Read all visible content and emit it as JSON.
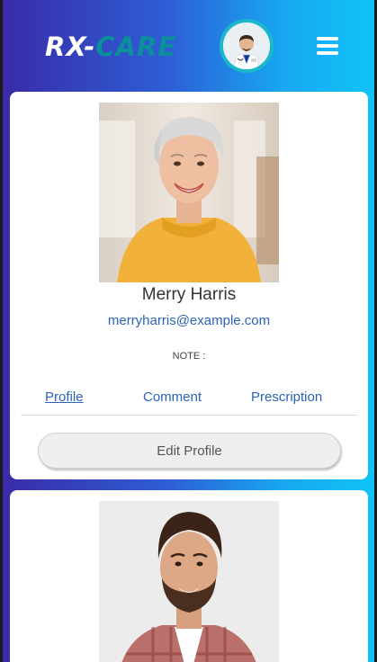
{
  "header": {
    "logo_prefix": "RX-",
    "logo_suffix": "CARE",
    "avatar_icon": "doctor-avatar",
    "menu_icon": "hamburger-menu-icon"
  },
  "colors": {
    "accent_blue": "#2a63b8",
    "logo_teal": "#0b8f9a",
    "avatar_ring": "#1ab8c9"
  },
  "patients": [
    {
      "name": "Merry Harris",
      "email": "merryharris@example.com",
      "note_label": "NOTE :",
      "tabs": [
        "Profile",
        "Comment",
        "Prescription"
      ],
      "active_tab": "Profile",
      "edit_label": "Edit Profile"
    },
    {
      "photo": "man-portrait"
    }
  ]
}
